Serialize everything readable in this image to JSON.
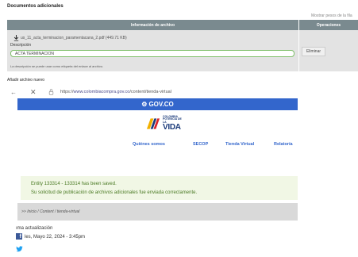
{
  "section": {
    "title": "Documentos adicionales",
    "show_weights": "Mostrar pesos de la fila"
  },
  "table": {
    "headers": {
      "info": "Información de archivo",
      "ops": "Operaciones"
    },
    "file_name": "us_11_acta_terminacion_paramentacana_2.pdf (449.71 KB)",
    "description_label": "Descripción",
    "description_value": "ACTA TERMINACIÓN",
    "help_text": "La descripción se puede usar como etiqueta del enlace al archivo.",
    "delete_label": "Eliminar"
  },
  "add_file": {
    "label": "Añadir archivo nuevo"
  },
  "browser": {
    "back_glyph": "←",
    "close_glyph": "✕",
    "url_prefix": "https://",
    "url_host": "www.colombiacompra.gov.co",
    "url_path": "/content/tienda-virtual"
  },
  "site": {
    "gov_label": "GOV.CO",
    "gov_mark": "⚙",
    "logo_small": "COLOMBIA\nPOTENCIA DE LA",
    "logo_big": "VIDA",
    "menu": [
      "Quiénes somos",
      "SECOP",
      "Tienda Virtual",
      "Relatoría"
    ],
    "alert": [
      "Entity 133314 - 133314 has been saved.",
      "Su solicitud de publicación de archivos adicionales fue enviada correctamente."
    ],
    "breadcrumb": ">> Inicio / Content / tienda-virtual",
    "update_title": "ıma actualización",
    "update_date": "les, Mayo 22, 2024 - 3:45pm",
    "fb_glyph": "f"
  },
  "colors": {
    "header_bg": "#7a8a8f",
    "gov_blue": "#3366cc",
    "alert_bg": "#f1f7e5",
    "alert_text": "#4a7a24",
    "facebook": "#3b5998",
    "twitter": "#1da1f2",
    "logo_yellow": "#f2b100"
  }
}
